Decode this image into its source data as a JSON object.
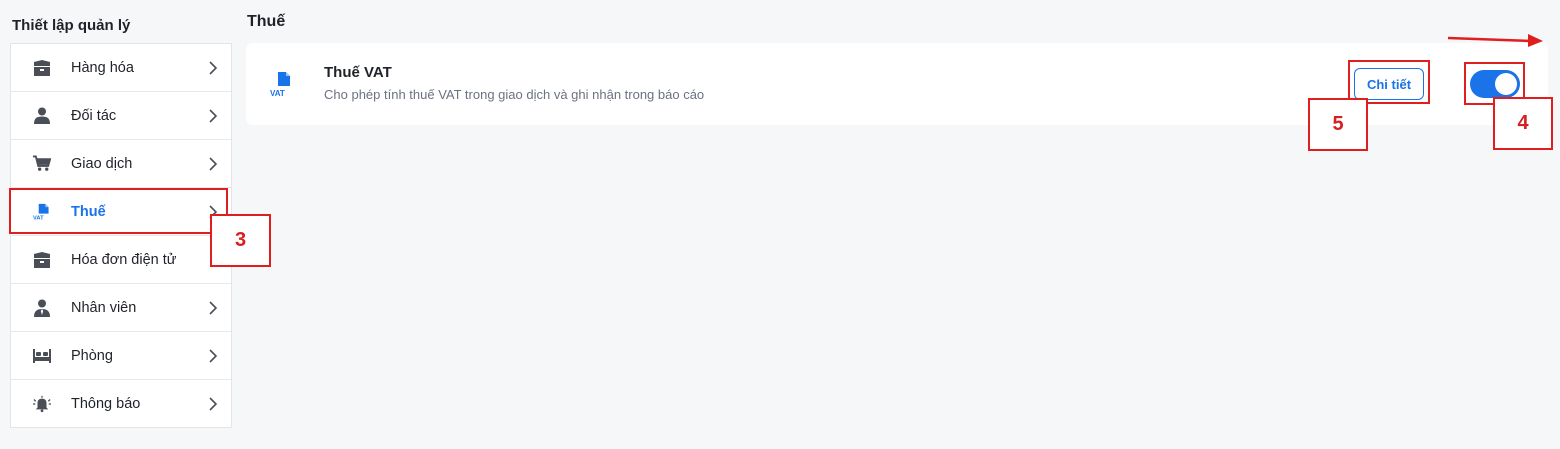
{
  "sidebar": {
    "title": "Thiết lập quản lý",
    "items": [
      {
        "label": "Hàng hóa",
        "icon": "box-icon"
      },
      {
        "label": "Đối tác",
        "icon": "user-icon"
      },
      {
        "label": "Giao dịch",
        "icon": "cart-icon"
      },
      {
        "label": "Thuế",
        "icon": "vat-document-icon",
        "active": true
      },
      {
        "label": "Hóa đơn điện tử",
        "icon": "box-icon"
      },
      {
        "label": "Nhân viên",
        "icon": "employee-icon"
      },
      {
        "label": "Phòng",
        "icon": "bed-icon"
      },
      {
        "label": "Thông báo",
        "icon": "bell-icon"
      }
    ]
  },
  "main": {
    "title": "Thuế",
    "card": {
      "title": "Thuế VAT",
      "description": "Cho phép tính thuế VAT trong giao dịch và ghi nhận trong báo cáo",
      "icon_text": "VAT",
      "detail_label": "Chi tiết",
      "toggle_on": true
    }
  },
  "annotations": {
    "n3": "3",
    "n4": "4",
    "n5": "5"
  },
  "colors": {
    "accent": "#1a73e8",
    "annotation": "#e01e1e",
    "icon": "#4a4f57"
  }
}
